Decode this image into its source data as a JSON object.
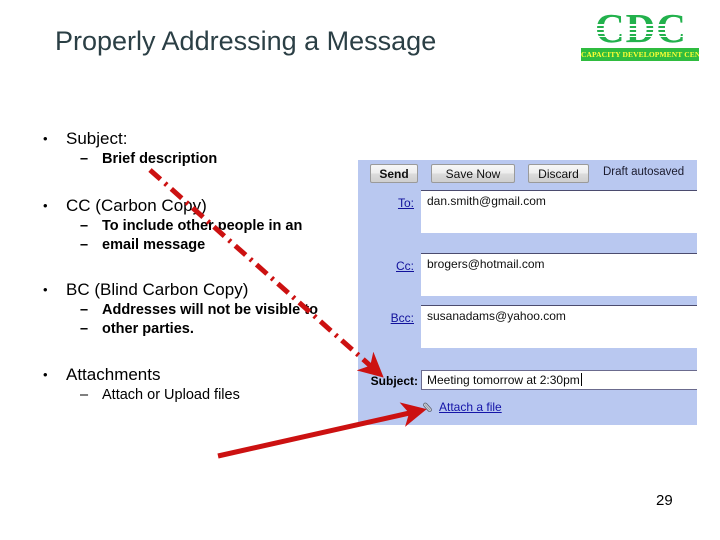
{
  "slide": {
    "title": "Properly Addressing a Message",
    "page_number": "29"
  },
  "logo": {
    "mark": "CDC",
    "banner": "CAPACITY DEVELOPMENT CENTER",
    "mark_color": "#22b14c",
    "banner_bg": "#2fbc3f",
    "banner_text_color": "#ffff33"
  },
  "bullets": [
    {
      "level1": "Subject:",
      "level2": [
        "Brief description"
      ]
    },
    {
      "level1": "CC (Carbon Copy)",
      "level2": [
        "To include other people in an",
        "email message"
      ]
    },
    {
      "level1": "BC (Blind Carbon Copy)",
      "level2": [
        "Addresses will not be visible to",
        "other parties."
      ]
    },
    {
      "level1": "Attachments",
      "level2": [
        "Attach or Upload files"
      ]
    }
  ],
  "bullet_text": {
    "b1_l1": "Subject:",
    "b1_l2_a": "Brief description",
    "b2_l1": "CC (Carbon Copy)",
    "b2_l2_a": "To include other people in an",
    "b2_l2_b": "email message",
    "b3_l1": "BC (Blind Carbon Copy)",
    "b3_l2_a": "Addresses will not be visible to",
    "b3_l2_b": "other parties.",
    "b4_l1": "Attachments",
    "b4_l2_a": "Attach or Upload files"
  },
  "mail": {
    "panel_bg": "#b9c8f0",
    "toolbar": {
      "send_label": "Send",
      "save_label": "Save Now",
      "discard_label": "Discard",
      "status": "Draft autosaved"
    },
    "fields": {
      "to_label": "To:",
      "to_value": "dan.smith@gmail.com",
      "cc_label": "Cc:",
      "cc_value": "brogers@hotmail.com",
      "bcc_label": "Bcc:",
      "bcc_value": "susanadams@yahoo.com",
      "subject_label": "Subject:",
      "subject_value": "Meeting tomorrow at 2:30pm"
    },
    "attach": {
      "link_label": "Attach a file",
      "icon": "paperclip-icon"
    },
    "link_color": "#11119b"
  },
  "annotations": {
    "arrow_color": "#cc1111",
    "arrow_1": "dash-dot arrow from 'Brief description' to Subject field",
    "arrow_2": "solid arrow from 'Attach or Upload files' to Attach a file link"
  }
}
